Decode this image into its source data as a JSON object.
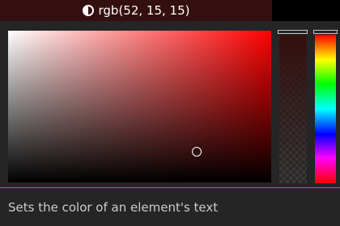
{
  "header": {
    "color_label": "rgb(52, 15, 15)",
    "current_color": "#340f0f",
    "contrast_icon": "contrast-icon"
  },
  "picker": {
    "hue_color": "#ff0000",
    "opacity_level": 1.0
  },
  "status": {
    "text": "Sets the color of an element's text"
  },
  "colors": {
    "accent": "#3c8ec7",
    "background": "#252526"
  }
}
